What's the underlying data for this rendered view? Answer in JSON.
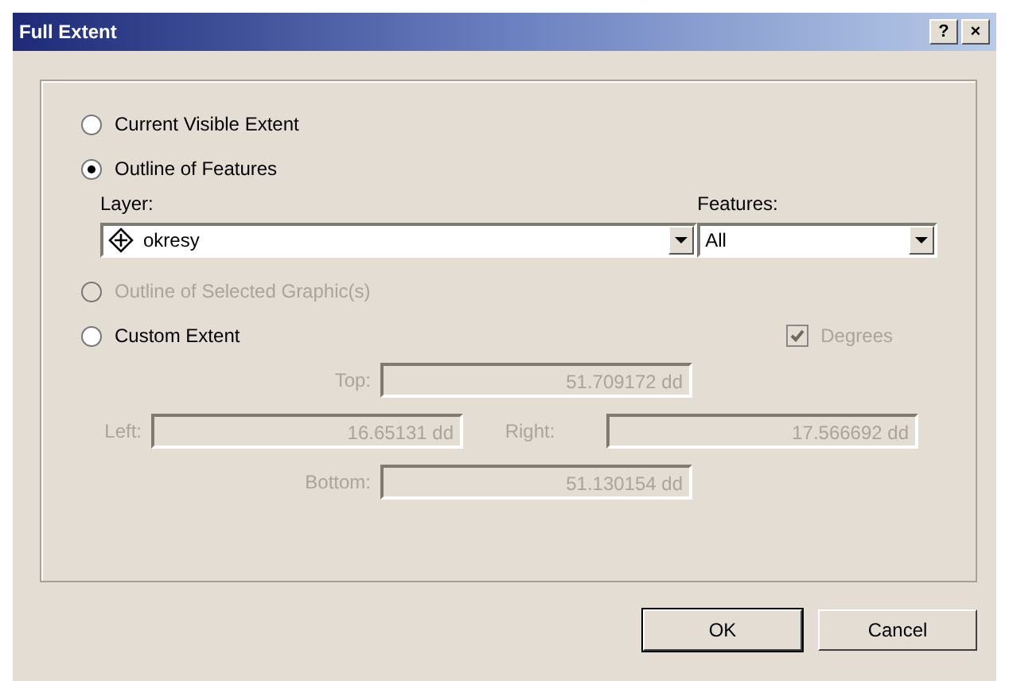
{
  "window": {
    "title": "Full Extent",
    "help": "?",
    "close": "×"
  },
  "options": [
    {
      "label": "Current Visible Extent",
      "selected": false,
      "disabled": false
    },
    {
      "label": "Outline of Features",
      "selected": true,
      "disabled": false
    },
    {
      "label": "Outline of Selected Graphic(s)",
      "selected": false,
      "disabled": true
    },
    {
      "label": "Custom Extent",
      "selected": false,
      "disabled": false
    }
  ],
  "layer": {
    "label": "Layer:",
    "value": "okresy"
  },
  "features": {
    "label": "Features:",
    "value": "All"
  },
  "degrees": {
    "label": "Degrees",
    "checked": true,
    "disabled": true
  },
  "extent": {
    "disabled": true,
    "top": {
      "label": "Top:",
      "value": "51.709172 dd"
    },
    "left": {
      "label": "Left:",
      "value": "16.65131 dd"
    },
    "right": {
      "label": "Right:",
      "value": "17.566692 dd"
    },
    "bottom": {
      "label": "Bottom:",
      "value": "51.130154 dd"
    }
  },
  "buttons": [
    "OK",
    "Cancel"
  ]
}
